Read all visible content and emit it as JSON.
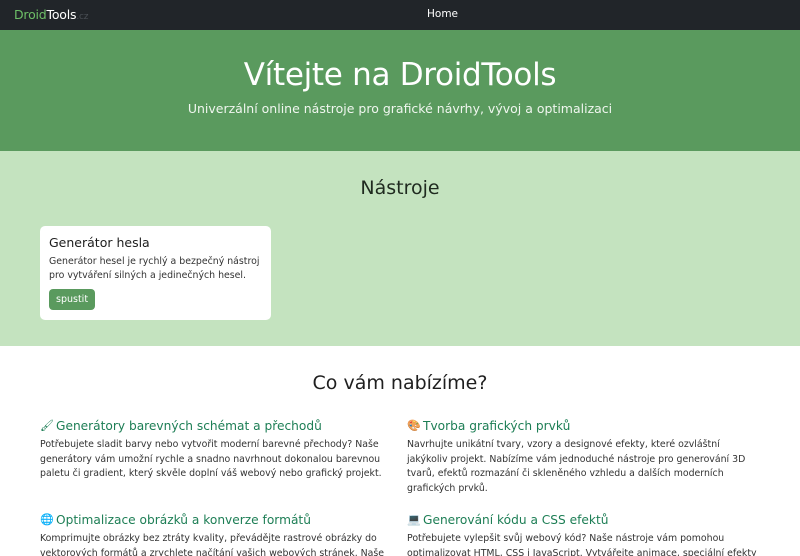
{
  "navbar": {
    "brand_part1": "Droid",
    "brand_part2": "Tools",
    "brand_suffix": ".cz",
    "home_link": "Home"
  },
  "hero": {
    "title": "Vítejte na DroidTools",
    "subtitle": "Univerzální online nástroje pro grafické návrhy, vývoj a optimalizaci"
  },
  "tools": {
    "heading": "Nástroje",
    "cards": [
      {
        "title": "Generátor hesla",
        "description": "Generátor hesel je rychlý a bezpečný nástroj pro vytváření silných a jedinečných hesel.",
        "button_label": "spustit"
      }
    ]
  },
  "offer": {
    "heading": "Co vám nabízíme?",
    "features": [
      {
        "icon": "paintbrush-icon",
        "icon_glyph": "🖌",
        "title": "Generátory barevných schémat a přechodů",
        "text": "Potřebujete sladit barvy nebo vytvořit moderní barevné přechody? Naše generátory vám umožní rychle a snadno navrhnout dokonalou barevnou paletu či gradient, který skvěle doplní váš webový nebo grafický projekt."
      },
      {
        "icon": "palette-icon",
        "icon_glyph": "🎨",
        "title": "Tvorba grafických prvků",
        "text": "Navrhujte unikátní tvary, vzory a designové efekty, které ozvláštní jakýkoliv projekt. Nabízíme vám jednoduché nástroje pro generování 3D tvarů, efektů rozmazání či skleněného vzhledu a dalších moderních grafických prvků."
      },
      {
        "icon": "globe-icon",
        "icon_glyph": "🌐",
        "title": "Optimalizace obrázků a konverze formátů",
        "text": "Komprimujte obrázky bez ztráty kvality, převádějte rastrové obrázky do vektorových formátů a zrychlete načítání vašich webových stránek. Naše"
      },
      {
        "icon": "laptop-icon",
        "icon_glyph": "💻",
        "title": "Generování kódu a CSS efektů",
        "text": "Potřebujete vylepšit svůj webový kód? Naše nástroje vám pomohou optimalizovat HTML, CSS i JavaScript. Vytvářejte animace, speciální efekty nebo"
      }
    ]
  }
}
